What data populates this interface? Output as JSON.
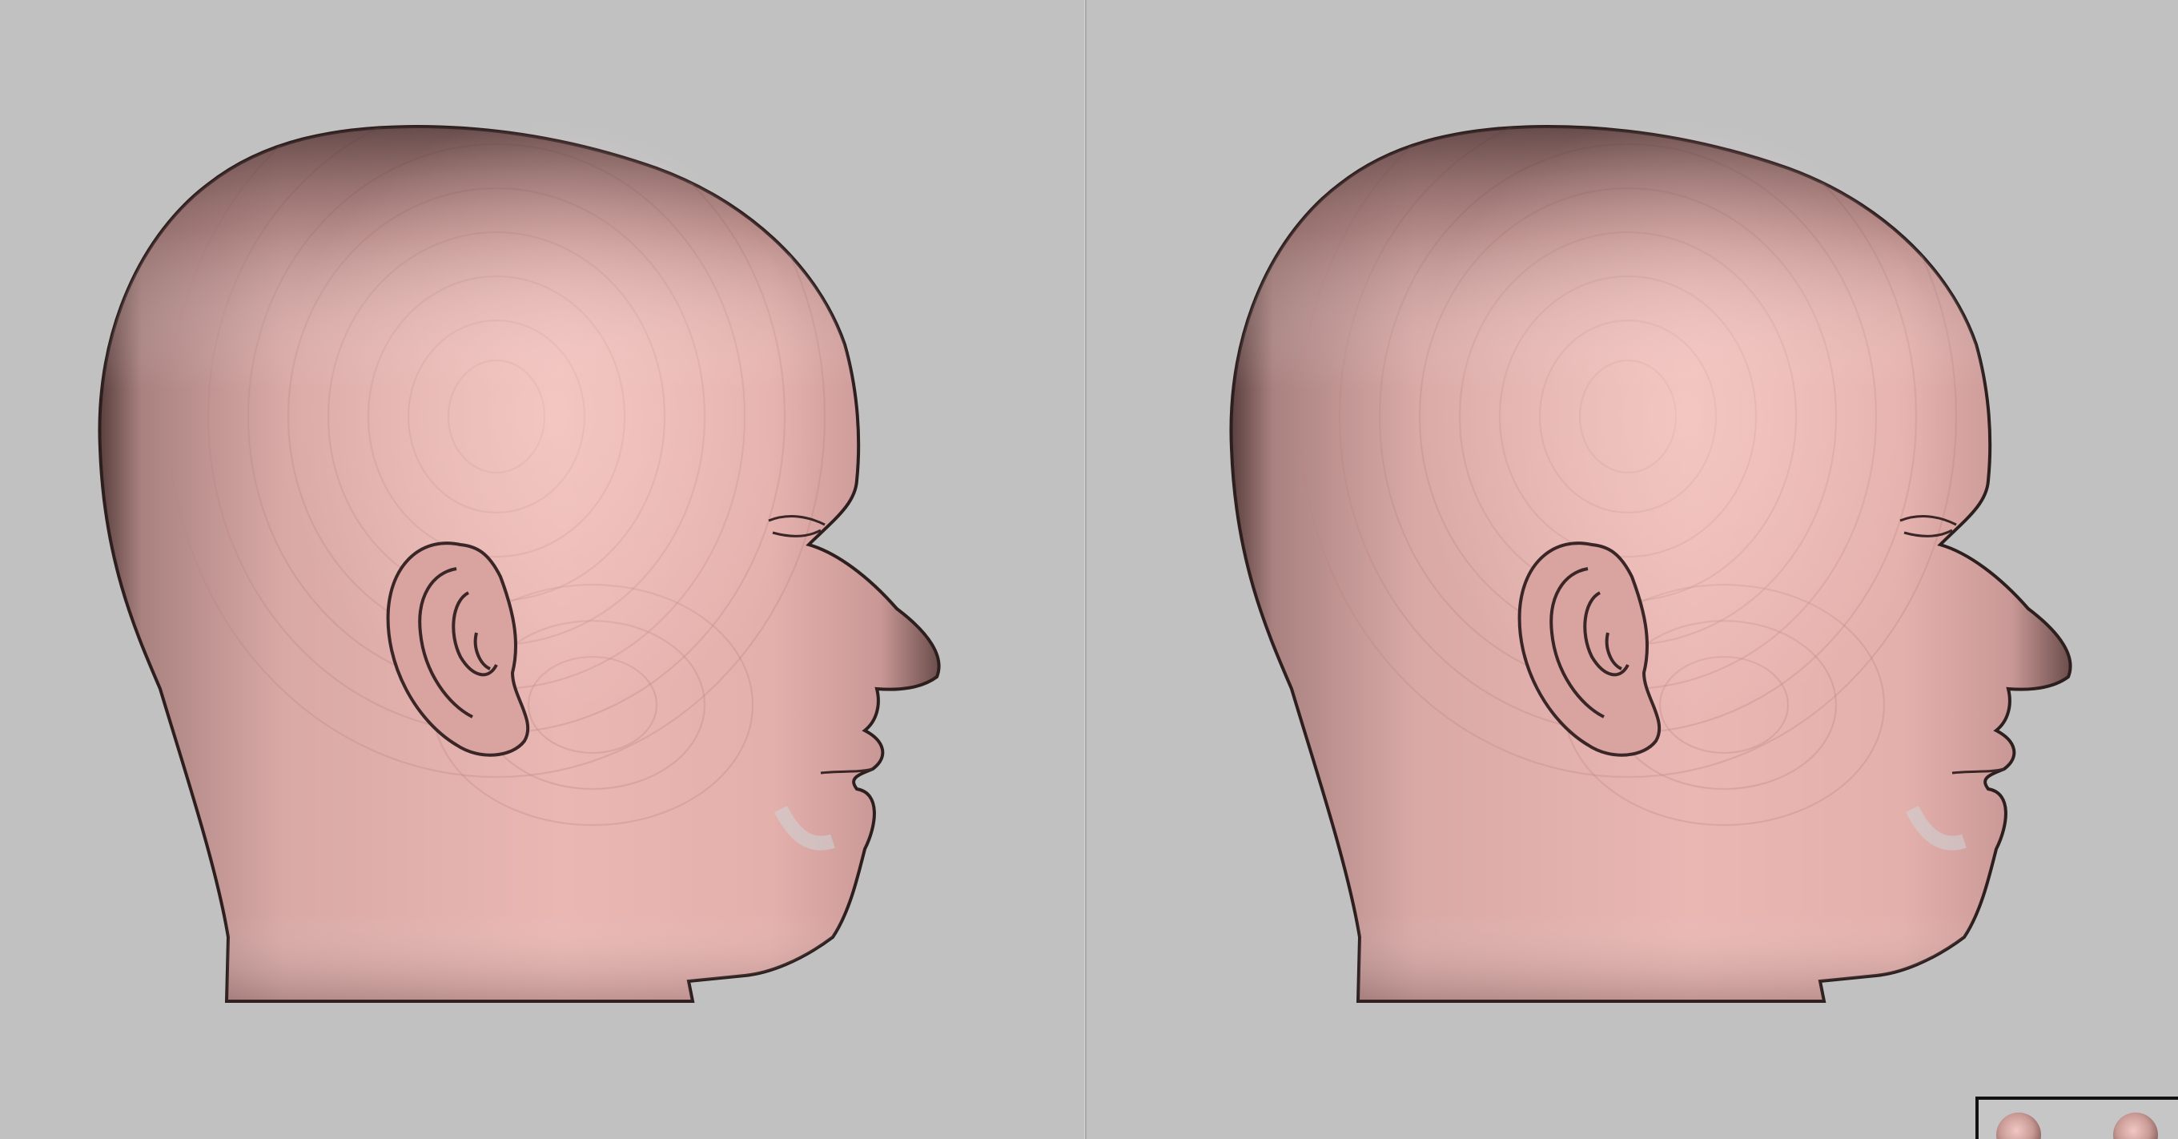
{
  "viewer": {
    "layout": "split-view",
    "background_color": "#c1c1c1",
    "model_color": "#e8b4b0",
    "viewports": [
      {
        "name": "left",
        "content": "head-model-side-view"
      },
      {
        "name": "right",
        "content": "head-model-side-view"
      }
    ]
  },
  "thumbnails": {
    "items": [
      {
        "icon": "head-thumbnail-icon"
      },
      {
        "icon": "head-thumbnail-icon"
      }
    ]
  }
}
